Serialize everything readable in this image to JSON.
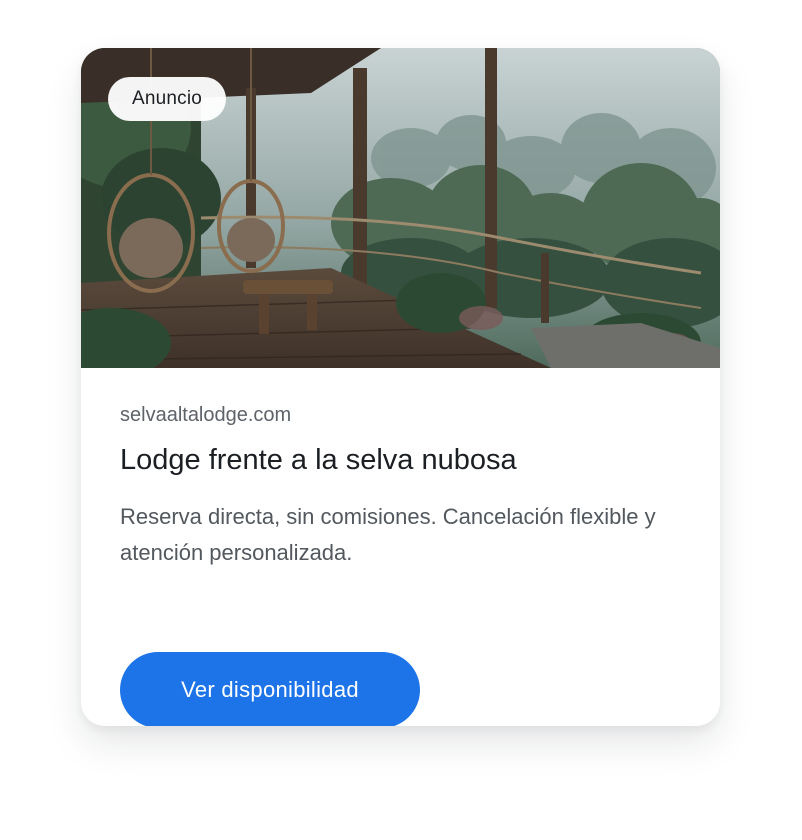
{
  "ad": {
    "badge_label": "Anuncio",
    "domain": "selvaaltalodge.com",
    "title": "Lodge frente a la selva nubosa",
    "description": "Reserva directa, sin comisiones. Cancelación flexible y atención personalizada.",
    "cta_label": "Ver disponibilidad"
  },
  "colors": {
    "cta_background": "#1d74e8",
    "card_background": "#ffffff",
    "badge_background": "#ffffff"
  }
}
